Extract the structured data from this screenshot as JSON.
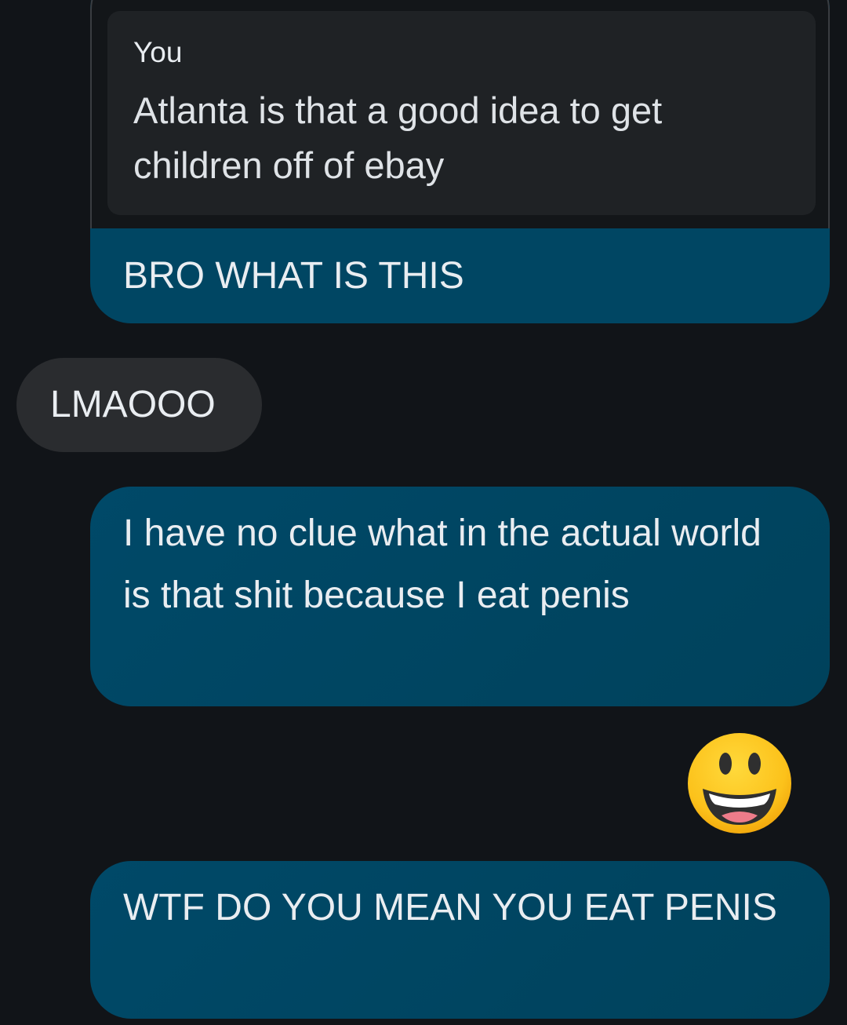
{
  "thread": {
    "reply_message": {
      "quoted_author": "You",
      "quoted_text": "Atlanta is that a good idea to get children off of ebay",
      "text": "BRO WHAT IS THIS"
    },
    "incoming_message": {
      "text": "LMAOOO"
    },
    "outgoing_message_1": {
      "text": "I have no clue what in the actual world is that shit because I eat penis"
    },
    "emoji_message": {
      "emoji": "grinning-face-with-big-eyes"
    },
    "outgoing_message_2": {
      "text": "WTF DO YOU MEAN YOU EAT PENIS"
    }
  },
  "colors": {
    "background": "#111418",
    "outgoing_bubble": "#004663",
    "incoming_bubble": "#2a2c2f",
    "quote_card": "#1f2225",
    "emoji_yellow": "#fcc21b"
  }
}
